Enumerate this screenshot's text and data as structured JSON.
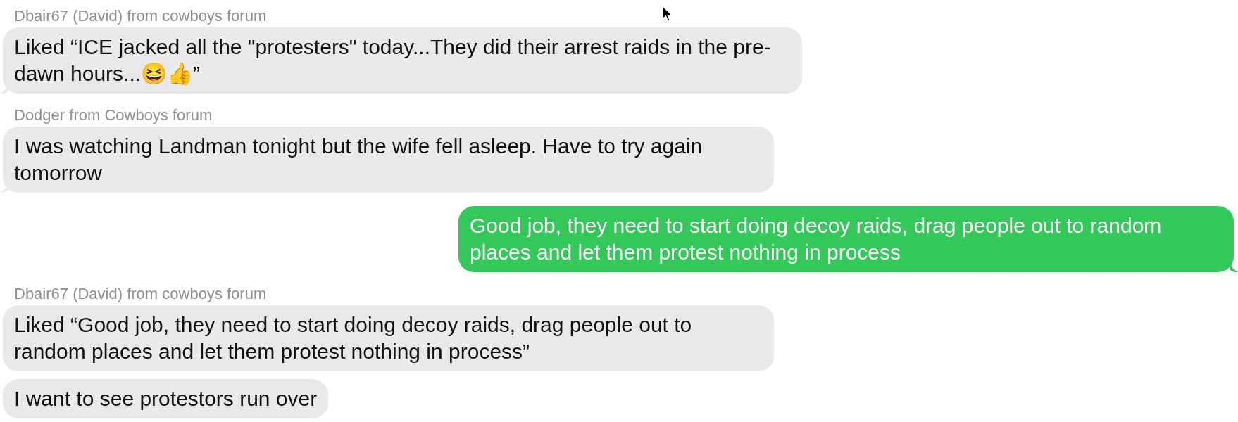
{
  "messages": [
    {
      "kind": "incoming",
      "sender": "Dbair67 (David) from cowboys forum",
      "text": "Liked “ICE jacked all the \"protesters\" today...They did their arrest raids in the pre-dawn hours...😆👍”",
      "tail": true
    },
    {
      "kind": "incoming",
      "sender": "Dodger from Cowboys forum",
      "text": "I was watching Landman tonight but the wife fell asleep. Have to try again tomorrow",
      "tail": true
    },
    {
      "kind": "outgoing",
      "text": "Good job, they need to start doing decoy raids, drag people out to random places and let them protest nothing in process",
      "tail": true
    },
    {
      "kind": "incoming",
      "sender": "Dbair67 (David) from cowboys forum",
      "text": "Liked “Good job, they need to start doing decoy raids, drag people out to random places and let them protest nothing in process”",
      "tail": false
    },
    {
      "kind": "incoming",
      "text": "I want to see protestors run over",
      "tail": false
    }
  ]
}
